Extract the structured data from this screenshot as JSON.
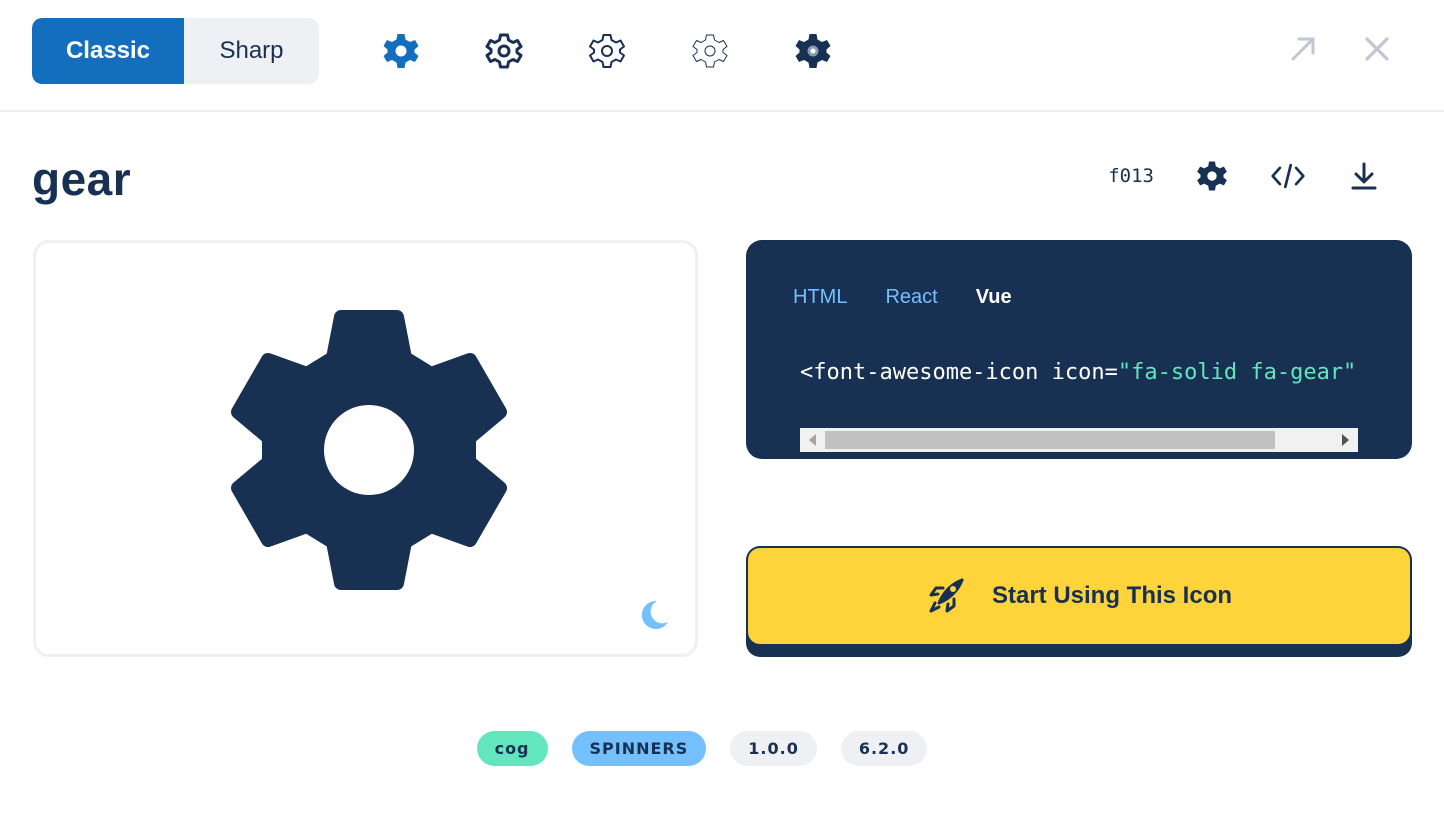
{
  "topbar": {
    "family_options": [
      {
        "label": "Classic",
        "active": true
      },
      {
        "label": "Sharp",
        "active": false
      }
    ],
    "styles": [
      {
        "name": "solid",
        "color": "#146ebe"
      },
      {
        "name": "regular",
        "color": "#183153"
      },
      {
        "name": "light",
        "color": "#183153"
      },
      {
        "name": "thin",
        "color": "#183153"
      },
      {
        "name": "duotone",
        "color": "#183153"
      }
    ],
    "actions": [
      "expand-icon",
      "close-icon"
    ]
  },
  "icon": {
    "name": "gear",
    "unicode": "f013"
  },
  "preview": {
    "icon_color": "#183153",
    "mode_toggle_icon": "moon-icon"
  },
  "code": {
    "tabs": [
      {
        "label": "HTML",
        "active": false
      },
      {
        "label": "React",
        "active": false
      },
      {
        "label": "Vue",
        "active": true
      }
    ],
    "snippet_prefix": "<font-awesome-icon icon=",
    "snippet_value": "\"fa-solid fa-gear\""
  },
  "cta": {
    "label": "Start Using This Icon",
    "bg_color": "#ffd43b"
  },
  "tags": [
    {
      "label": "cog",
      "color": "#63e6be"
    },
    {
      "label": "SPINNERS",
      "color": "#74c0fc"
    },
    {
      "label": "1.0.0",
      "color": "#eef0f3"
    },
    {
      "label": "6.2.0",
      "color": "#eef0f3"
    }
  ]
}
